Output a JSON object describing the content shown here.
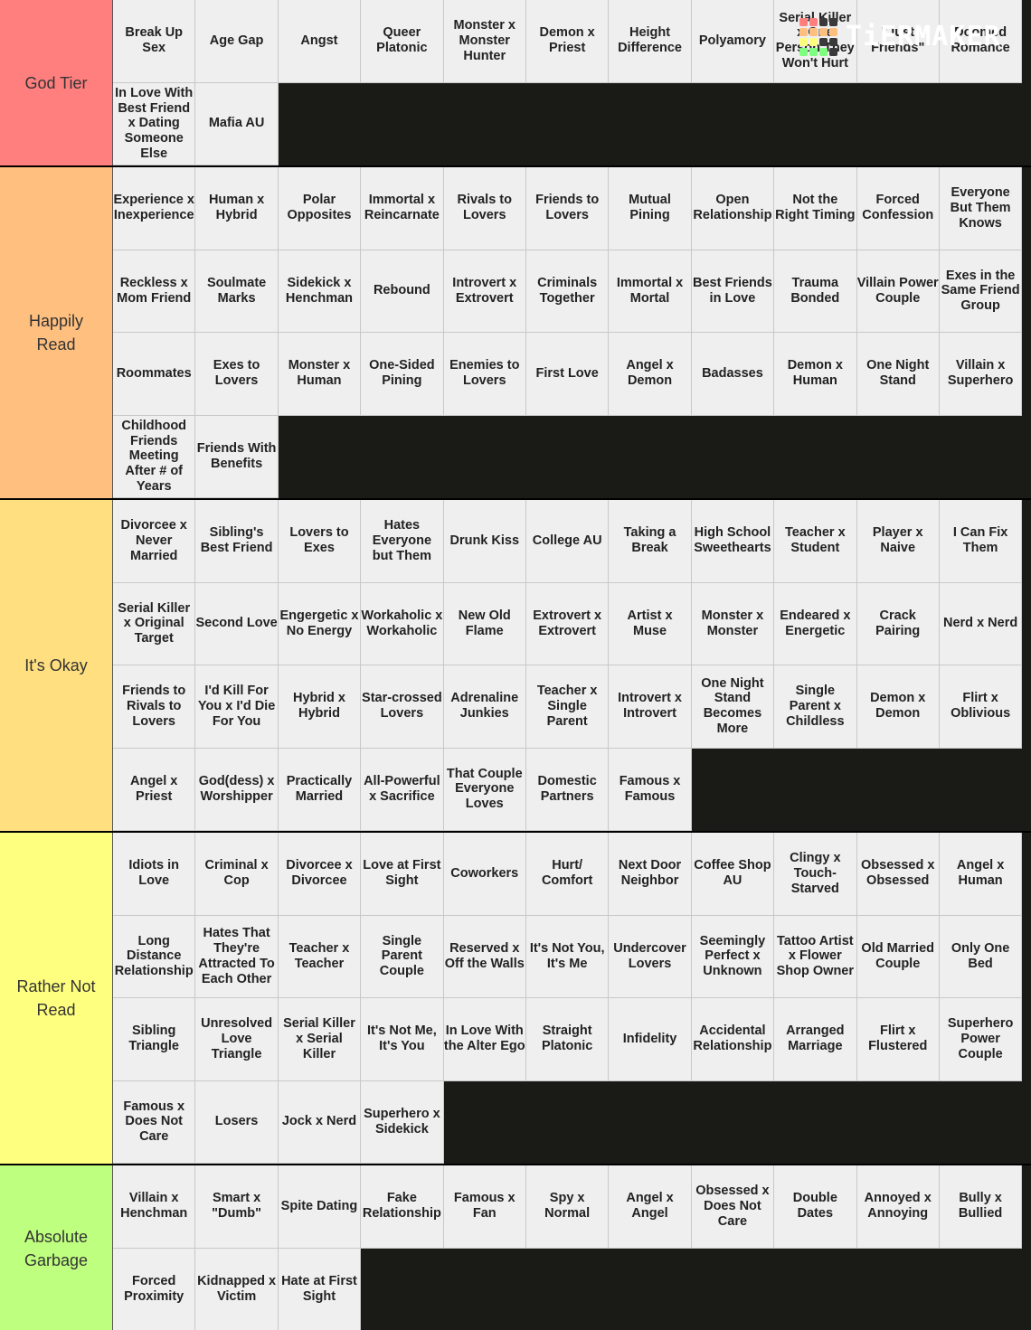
{
  "brand": {
    "name": "TiERMAKER",
    "logo_grid_colors": [
      [
        "#ff7f7f",
        "#ff7f7f",
        "#3a3a3a",
        "#3a3a3a"
      ],
      [
        "#ffbf7f",
        "#ffbf7f",
        "#ffbf7f",
        "#ffbf7f"
      ],
      [
        "#ffff7f",
        "#ffff7f",
        "#3a3a3a",
        "#3a3a3a"
      ],
      [
        "#7fff7f",
        "#7fff7f",
        "#7fff7f",
        "#3a3a3a"
      ]
    ]
  },
  "background_color": "#1a1a17",
  "tiers": [
    {
      "label": "God Tier",
      "color": "#ff7f7f",
      "items": [
        "Break Up Sex",
        "Age Gap",
        "Angst",
        "Queer Platonic",
        "Monster x Monster Hunter",
        "Demon x Priest",
        "Height Difference",
        "Polyamory",
        "Serial Killer x One Person They Won't Hurt",
        "\"Just Friends\"",
        "Doomed Romance",
        "In Love With Best Friend x Dating Someone Else",
        "Mafia AU"
      ]
    },
    {
      "label": "Happily Read",
      "color": "#ffbf7f",
      "items": [
        "Experience x Inexperience",
        "Human x Hybrid",
        "Polar Opposites",
        "Immortal x Reincarnate",
        "Rivals to Lovers",
        "Friends to Lovers",
        "Mutual Pining",
        "Open Relationship",
        "Not the Right Timing",
        "Forced Confession",
        "Everyone But Them Knows",
        "Reckless x Mom Friend",
        "Soulmate Marks",
        "Sidekick x Henchman",
        "Rebound",
        "Introvert x Extrovert",
        "Criminals Together",
        "Immortal x Mortal",
        "Best Friends in Love",
        "Trauma Bonded",
        "Villain Power Couple",
        "Exes in the Same Friend Group",
        "Roommates",
        "Exes to Lovers",
        "Monster x Human",
        "One-Sided Pining",
        "Enemies to Lovers",
        "First Love",
        "Angel x Demon",
        "Badasses",
        "Demon x Human",
        "One Night Stand",
        "Villain x Superhero",
        "Childhood Friends Meeting After # of Years",
        "Friends With Benefits"
      ]
    },
    {
      "label": "It's Okay",
      "color": "#ffdf7f",
      "items": [
        "Divorcee x Never Married",
        "Sibling's Best Friend",
        "Lovers to Exes",
        "Hates Everyone but Them",
        "Drunk Kiss",
        "College AU",
        "Taking a Break",
        "High School Sweethearts",
        "Teacher x Student",
        "Player x Naive",
        "I Can Fix Them",
        "Serial Killer x Original Target",
        "Second Love",
        "Engergetic x No Energy",
        "Workaholic x Workaholic",
        "New Old Flame",
        "Extrovert x Extrovert",
        "Artist x Muse",
        "Monster x Monster",
        "Endeared x Energetic",
        "Crack Pairing",
        "Nerd x Nerd",
        "Friends to Rivals to Lovers",
        "I'd Kill For You x I'd Die For You",
        "Hybrid x Hybrid",
        "Star-crossed Lovers",
        "Adrenaline Junkies",
        "Teacher x Single Parent",
        "Introvert x Introvert",
        "One Night Stand Becomes More",
        "Single Parent x Childless",
        "Demon x Demon",
        "Flirt x Oblivious",
        "Angel x Priest",
        "God(dess) x Worshipper",
        "Practically Married",
        "All-Powerful x Sacrifice",
        "That Couple Everyone Loves",
        "Domestic Partners",
        "Famous x Famous"
      ]
    },
    {
      "label": "Rather Not Read",
      "color": "#ffff7f",
      "items": [
        "Idiots in Love",
        "Criminal x Cop",
        "Divorcee x Divorcee",
        "Love at First Sight",
        "Coworkers",
        "Hurt/ Comfort",
        "Next Door Neighbor",
        "Coffee Shop AU",
        "Clingy x Touch-Starved",
        "Obsessed x Obsessed",
        "Angel x Human",
        "Long Distance Relationship",
        "Hates That They're Attracted To Each Other",
        "Teacher x Teacher",
        "Single Parent Couple",
        "Reserved x Off the Walls",
        "It's Not You, It's Me",
        "Undercover Lovers",
        "Seemingly Perfect x Unknown",
        "Tattoo Artist x Flower Shop Owner",
        "Old Married Couple",
        "Only One Bed",
        "Sibling Triangle",
        "Unresolved Love Triangle",
        "Serial Killer x Serial Killer",
        "It's Not Me, It's You",
        "In Love With the Alter Ego",
        "Straight Platonic",
        "Infidelity",
        "Accidental Relationship",
        "Arranged Marriage",
        "Flirt x Flustered",
        "Superhero Power Couple",
        "Famous x Does Not Care",
        "Losers",
        "Jock x Nerd",
        "Superhero x Sidekick"
      ]
    },
    {
      "label": "Absolute Garbage",
      "color": "#bfff7f",
      "items": [
        "Villain x Henchman",
        "Smart x \"Dumb\"",
        "Spite Dating",
        "Fake Relationship",
        "Famous x Fan",
        "Spy x Normal",
        "Angel x Angel",
        "Obsessed x Does Not Care",
        "Double Dates",
        "Annoyed x Annoying",
        "Bully x Bullied",
        "Forced Proximity",
        "Kidnapped x Victim",
        "Hate at First Sight"
      ]
    }
  ]
}
